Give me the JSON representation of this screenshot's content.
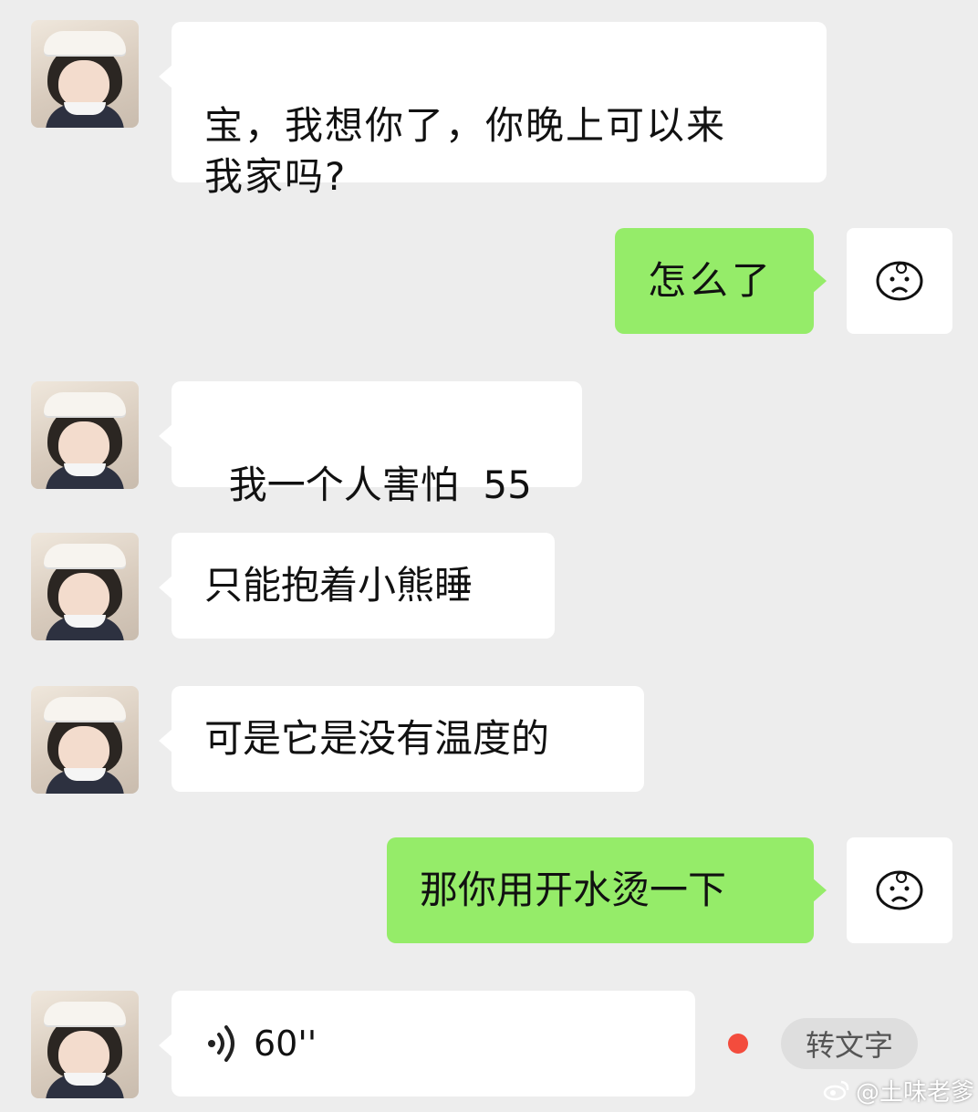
{
  "messages": [
    {
      "from": "other",
      "text": "宝，我想你了，你晚上可以来\n我家吗?"
    },
    {
      "from": "me",
      "text": "怎么了"
    },
    {
      "from": "other",
      "text": "我一个人害怕  55"
    },
    {
      "from": "other",
      "text": "只能抱着小熊睡"
    },
    {
      "from": "other",
      "text": "可是它是没有温度的"
    },
    {
      "from": "me",
      "text": "那你用开水烫一下"
    },
    {
      "from": "other",
      "type": "voice",
      "duration": "60''"
    }
  ],
  "voice_actions": {
    "convert_label": "转文字"
  },
  "icons": {
    "other_avatar": "girl-photo-avatar",
    "my_avatar": "doodle-face-avatar",
    "voice": "sound-wave-icon",
    "unread": "red-dot-icon",
    "watermark": "weibo-icon"
  },
  "watermark": {
    "text": "@土味老爹"
  },
  "colors": {
    "background": "#ededed",
    "incoming_bubble": "#ffffff",
    "outgoing_bubble": "#95ec69",
    "unread_dot": "#f34c3d"
  }
}
